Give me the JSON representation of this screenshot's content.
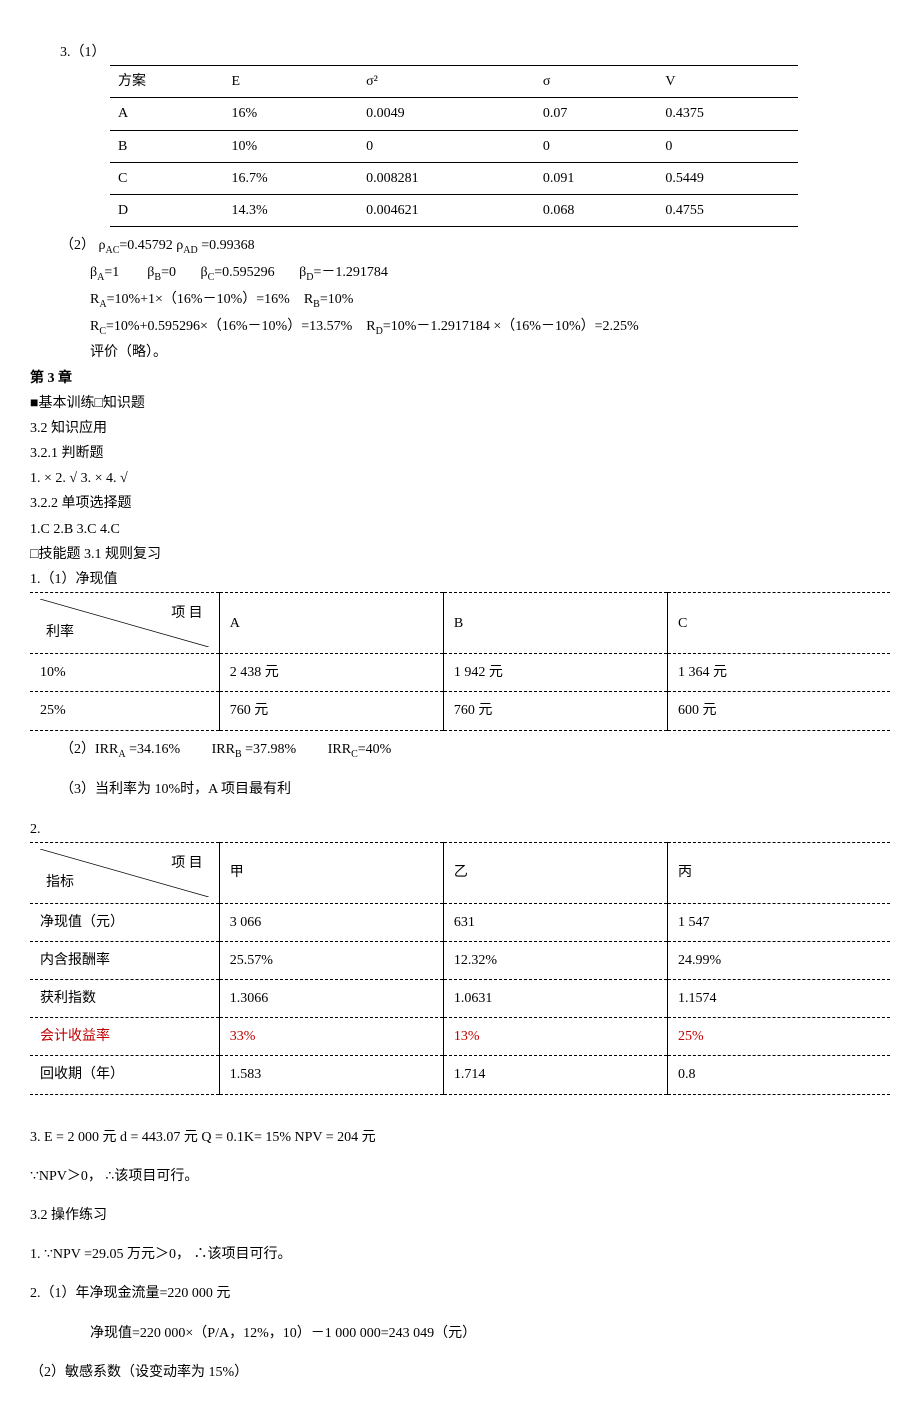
{
  "s31_label": "3.（1）",
  "table1": {
    "head": [
      "方案",
      "E",
      "σ²",
      "σ",
      "V"
    ],
    "rows": [
      [
        "A",
        "16%",
        "0.0049",
        "0.07",
        "0.4375"
      ],
      [
        "B",
        "10%",
        "0",
        "0",
        "0"
      ],
      [
        "C",
        "16.7%",
        "0.008281",
        "0.091",
        "0.5449"
      ],
      [
        "D",
        "14.3%",
        "0.004621",
        "0.068",
        "0.4755"
      ]
    ]
  },
  "calc": {
    "l1a": "（2） ρ",
    "l1b": "=0.45792  ρ",
    "l1c": " =0.99368",
    "sAC": "AC",
    "sAD": "AD",
    "l2a": "β",
    "l2b": "=1",
    "l2c": "β",
    "l2d": "=0",
    "l2e": "β",
    "l2f": "=0.595296",
    "l2g": "β",
    "l2h": "=－1.291784",
    "sA": "A",
    "sB": "B",
    "sC": "C",
    "sD": "D",
    "l3a": "R",
    "l3b": "=10%+1×（16%－10%）=16%",
    "l3c": "R",
    "l3d": "=10%",
    "l4a": "R",
    "l4b": "=10%+0.595296×（16%－10%）=13.57%",
    "l4c": "R",
    "l4d": "=10%－1.2917184 ×（16%－10%）=2.25%",
    "l5": "评价（略）。"
  },
  "ch3": {
    "title": "第 3 章",
    "l1": "■基本训练□知识题",
    "l2": "3.2 知识应用",
    "l3": "3.2.1 判断题",
    "l4": "1.  ×   2.  √   3.  ×   4.  √",
    "l5": "3.2.2 单项选择题",
    "l6": "1.C   2.B 3.C    4.C",
    "l7": "□技能题 3.1 规则复习",
    "l8": "1.（1）净现值"
  },
  "table2": {
    "diag_tr": "项 目",
    "diag_bl": "利率",
    "cols": [
      "A",
      "B",
      "C"
    ],
    "rows": [
      [
        "10%",
        "2 438 元",
        "1 942 元",
        "1 364 元"
      ],
      [
        "25%",
        "760 元",
        "760 元",
        "600 元"
      ]
    ]
  },
  "irr": {
    "a": "（2）IRR",
    "av": " =34.16%",
    "b": "IRR",
    "bv": " =37.98%",
    "c": "IRR",
    "cv": "=40%",
    "sA": "A",
    "sB": "B",
    "sC": "C"
  },
  "l_profit": "（3）当利率为 10%时，A 项目最有利",
  "l_two": "2.",
  "table3": {
    "diag_tr": "项 目",
    "diag_bl": "指标",
    "cols": [
      "甲",
      "乙",
      "丙"
    ],
    "rows": [
      {
        "c": [
          "净现值（元）",
          "3 066",
          "631",
          "1 547"
        ],
        "red": false
      },
      {
        "c": [
          "内含报酬率",
          "25.57%",
          "12.32%",
          "24.99%"
        ],
        "red": false
      },
      {
        "c": [
          "获利指数",
          "1.3066",
          "1.0631",
          "1.1574"
        ],
        "red": false
      },
      {
        "c": [
          "会计收益率",
          "33%",
          "13%",
          "25%"
        ],
        "red": true
      },
      {
        "c": [
          "回收期（年）",
          "1.583",
          "1.714",
          "0.8"
        ],
        "red": false
      }
    ]
  },
  "tail": {
    "l1": "3. E = 2 000 元    d = 443.07 元  Q = 0.1K= 15%   NPV = 204 元",
    "l2": "∵NPV＞0， ∴该项目可行。",
    "l3": "3.2 操作练习",
    "l4": "1. ∵NPV =29.05 万元＞0， ∴该项目可行。",
    "l5": "2.（1）年净现金流量=220 000 元",
    "l6": "净现值=220 000×（P/A，12%，10）－1 000 000=243 049（元）",
    "l7": "（2）敏感系数（设变动率为 15%）"
  }
}
